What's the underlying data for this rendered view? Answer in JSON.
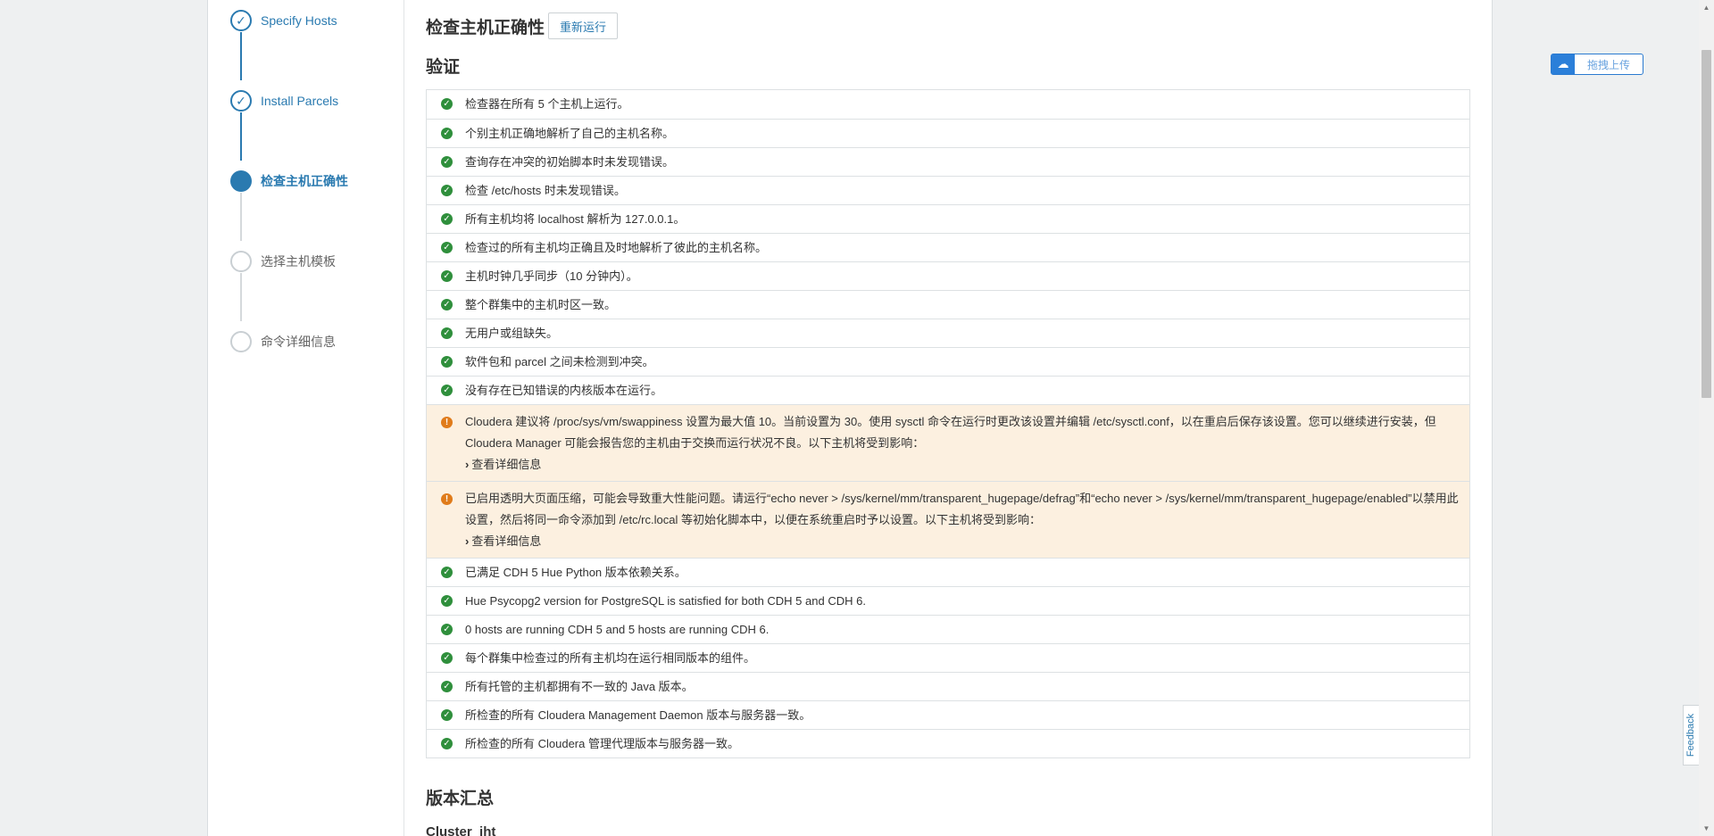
{
  "wizard": {
    "steps": [
      {
        "label": "Specify Hosts",
        "state": "done"
      },
      {
        "label": "Install Parcels",
        "state": "done"
      },
      {
        "label": "检查主机正确性",
        "state": "active"
      },
      {
        "label": "选择主机模板",
        "state": "todo"
      },
      {
        "label": "命令详细信息",
        "state": "todo"
      }
    ]
  },
  "page": {
    "title": "检查主机正确性",
    "rerun_label": "重新运行",
    "validation_title": "验证",
    "version_summary_title": "版本汇总",
    "cluster_name": "Cluster_jht"
  },
  "checks": [
    {
      "status": "ok",
      "text": "检查器在所有 5 个主机上运行。"
    },
    {
      "status": "ok",
      "text": "个别主机正确地解析了自己的主机名称。"
    },
    {
      "status": "ok",
      "text": "查询存在冲突的初始脚本时未发现错误。"
    },
    {
      "status": "ok",
      "text": "检查 /etc/hosts 时未发现错误。"
    },
    {
      "status": "ok",
      "text": "所有主机均将 localhost 解析为 127.0.0.1。"
    },
    {
      "status": "ok",
      "text": "检查过的所有主机均正确且及时地解析了彼此的主机名称。"
    },
    {
      "status": "ok",
      "text": "主机时钟几乎同步（10 分钟内）。"
    },
    {
      "status": "ok",
      "text": "整个群集中的主机时区一致。"
    },
    {
      "status": "ok",
      "text": "无用户或组缺失。"
    },
    {
      "status": "ok",
      "text": "软件包和 parcel 之间未检测到冲突。"
    },
    {
      "status": "ok",
      "text": "没有存在已知错误的内核版本在运行。"
    },
    {
      "status": "warn",
      "text": "Cloudera 建议将 /proc/sys/vm/swappiness 设置为最大值 10。当前设置为 30。使用 sysctl 命令在运行时更改该设置并编辑 /etc/sysctl.conf，以在重启后保存该设置。您可以继续进行安装，但 Cloudera Manager 可能会报告您的主机由于交换而运行状况不良。以下主机将受到影响：",
      "details": "查看详细信息"
    },
    {
      "status": "warn",
      "text": "已启用透明大页面压缩，可能会导致重大性能问题。请运行“echo never > /sys/kernel/mm/transparent_hugepage/defrag”和“echo never > /sys/kernel/mm/transparent_hugepage/enabled”以禁用此设置，然后将同一命令添加到 /etc/rc.local 等初始化脚本中，以便在系统重启时予以设置。以下主机将受到影响：",
      "details": "查看详细信息"
    },
    {
      "status": "ok",
      "text": "已满足 CDH 5 Hue Python 版本依赖关系。"
    },
    {
      "status": "ok",
      "text": "Hue Psycopg2 version for PostgreSQL is satisfied for both CDH 5 and CDH 6."
    },
    {
      "status": "ok",
      "text": "0 hosts are running CDH 5 and 5 hosts are running CDH 6."
    },
    {
      "status": "ok",
      "text": "每个群集中检查过的所有主机均在运行相同版本的组件。"
    },
    {
      "status": "ok",
      "text": "所有托管的主机都拥有不一致的 Java 版本。"
    },
    {
      "status": "ok",
      "text": "所检查的所有 Cloudera Management Daemon 版本与服务器一致。"
    },
    {
      "status": "ok",
      "text": "所检查的所有 Cloudera 管理代理版本与服务器一致。"
    }
  ],
  "upload_widget": {
    "label": "拖拽上传"
  },
  "feedback": {
    "label": "Feedback"
  },
  "colors": {
    "accent": "#2a7ab0",
    "ok": "#2f8f3c",
    "warn": "#e07b1a",
    "warn_bg": "#fcf0e0"
  }
}
